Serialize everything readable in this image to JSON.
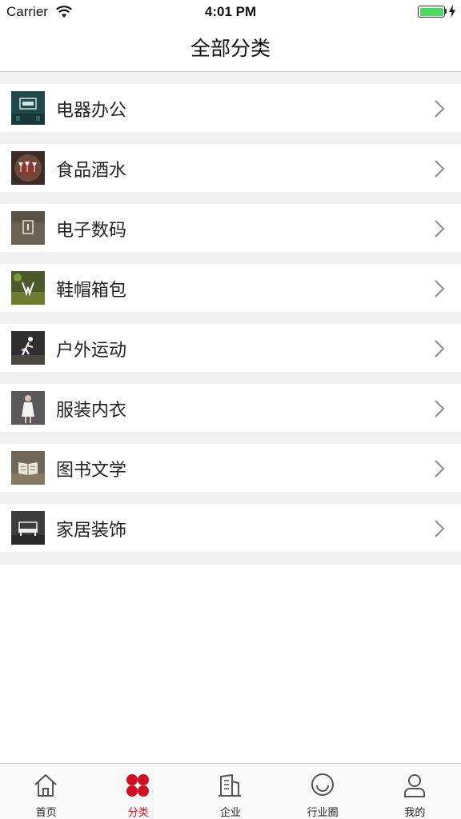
{
  "status_bar": {
    "carrier": "Carrier",
    "time": "4:01 PM",
    "battery_level": 1.0,
    "battery_color": "#4cd964"
  },
  "nav": {
    "title": "全部分类"
  },
  "categories": [
    {
      "label": "电器办公",
      "icon": "electrical-office-thumbnail",
      "thumb_color": "#1f4a49"
    },
    {
      "label": "食品酒水",
      "icon": "food-drinks-thumbnail",
      "thumb_color": "#3b2a25"
    },
    {
      "label": "电子数码",
      "icon": "electronics-thumbnail",
      "thumb_color": "#6b6254"
    },
    {
      "label": "鞋帽箱包",
      "icon": "shoes-bags-thumbnail",
      "thumb_color": "#4a5a2a"
    },
    {
      "label": "户外运动",
      "icon": "outdoor-sports-thumbnail",
      "thumb_color": "#2f2f2f"
    },
    {
      "label": "服装内衣",
      "icon": "apparel-thumbnail",
      "thumb_color": "#5a5858"
    },
    {
      "label": "图书文学",
      "icon": "books-thumbnail",
      "thumb_color": "#6e6656"
    },
    {
      "label": "家居装饰",
      "icon": "home-decor-thumbnail",
      "thumb_color": "#3d3d3d"
    }
  ],
  "tabs": [
    {
      "label": "首页",
      "icon": "home-icon",
      "active": false
    },
    {
      "label": "分类",
      "icon": "clover-icon",
      "active": true
    },
    {
      "label": "企业",
      "icon": "building-icon",
      "active": false
    },
    {
      "label": "行业圈",
      "icon": "smile-circle-icon",
      "active": false
    },
    {
      "label": "我的",
      "icon": "person-icon",
      "active": false
    }
  ],
  "colors": {
    "accent": "#d0101e",
    "separator": "#f0f0f0",
    "chevron": "#8a8a8a"
  }
}
